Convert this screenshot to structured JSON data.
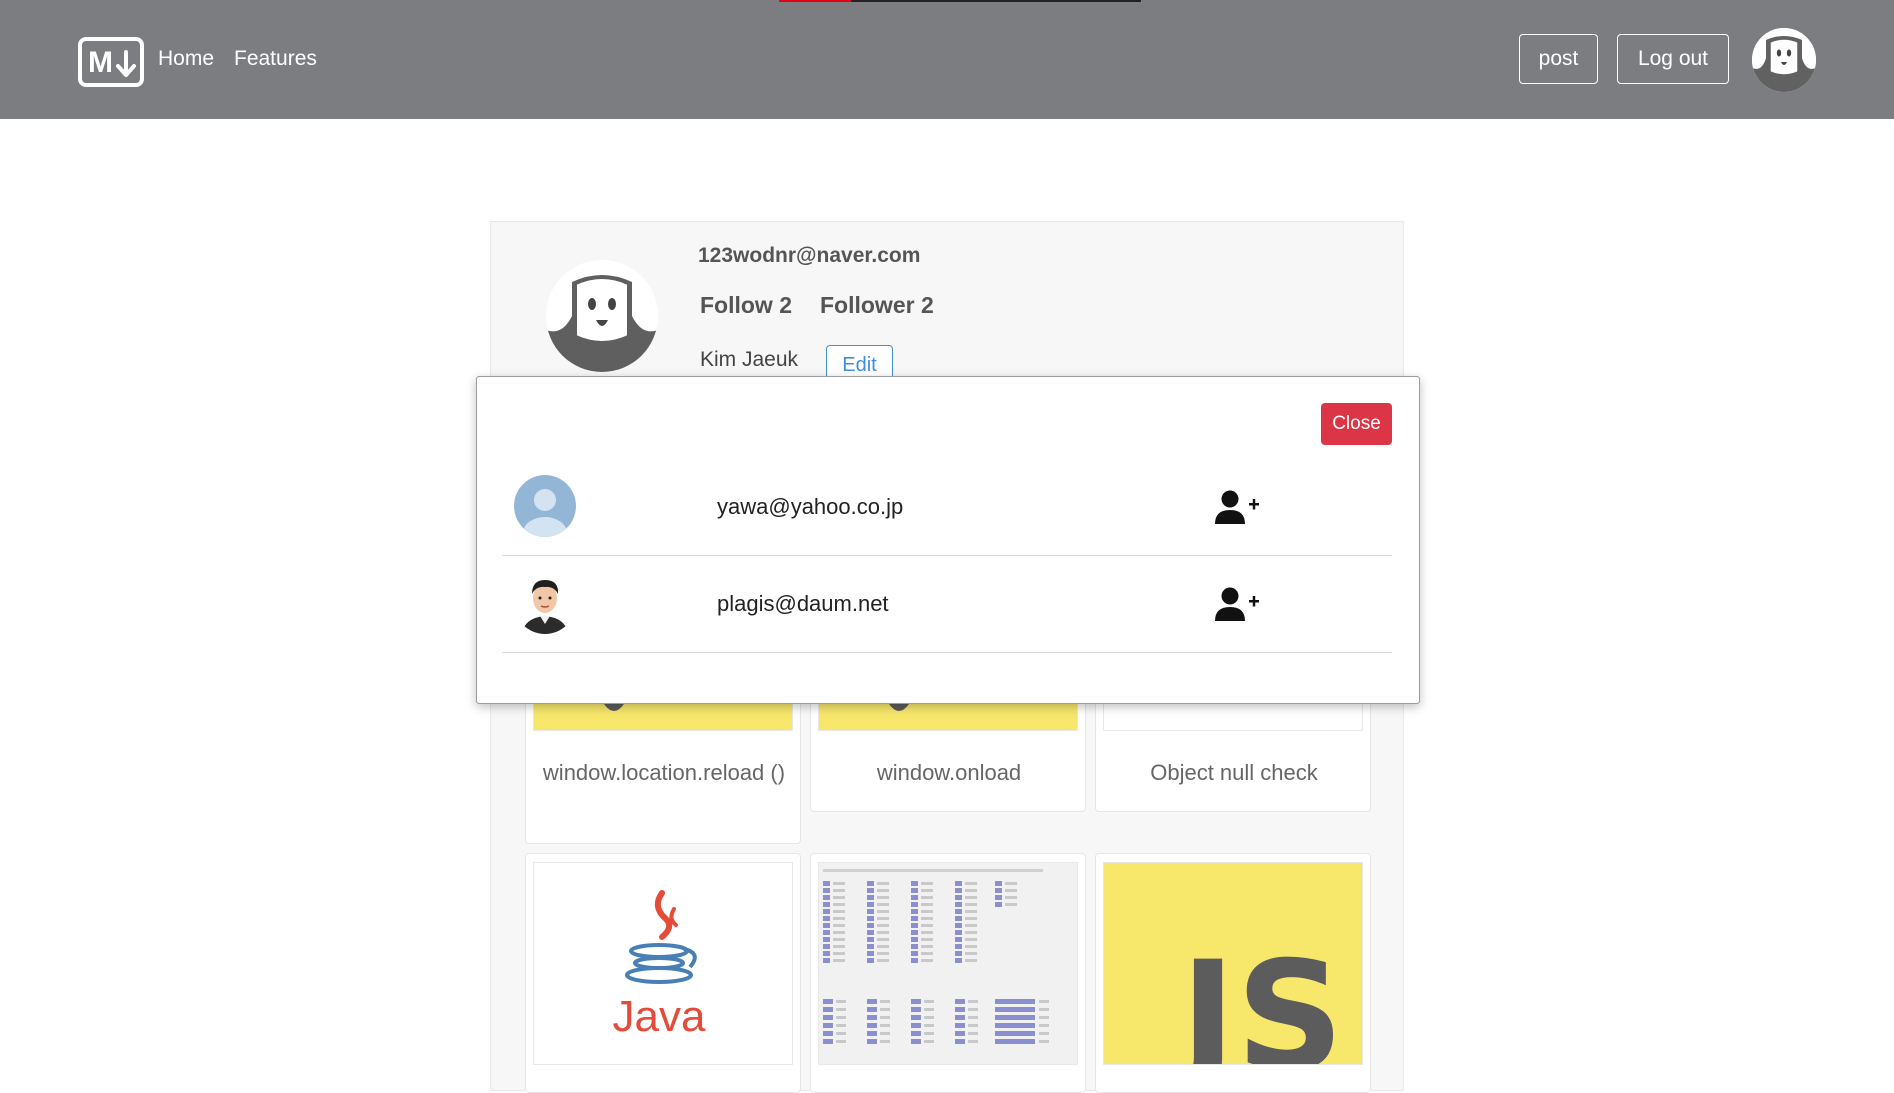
{
  "navbar": {
    "brand_logo_text": "M↓",
    "links": [
      "Home",
      "Features"
    ],
    "post_label": "post",
    "logout_label": "Log out",
    "background": "#7c7d80"
  },
  "profile": {
    "email": "123wodnr@naver.com",
    "follow_label": "Follow 2",
    "follower_label": "Follower 2",
    "name": "Kim Jaeuk",
    "edit_label": "Edit"
  },
  "posts": [
    {
      "title": "window.location.reload ()",
      "thumb": "js-logo"
    },
    {
      "title": "window.onload",
      "thumb": "js-logo"
    },
    {
      "title": "Object null check",
      "thumb": "blank"
    },
    {
      "title": "",
      "thumb": "java-logo",
      "thumb_text": "Java"
    },
    {
      "title": "",
      "thumb": "keycode-table"
    },
    {
      "title": "",
      "thumb": "js-logo",
      "thumb_text": "JS"
    }
  ],
  "modal": {
    "close_label": "Close",
    "users": [
      {
        "email": "yawa@yahoo.co.jp",
        "avatar": "default-avatar",
        "action": "add-user-icon"
      },
      {
        "email": "plagis@daum.net",
        "avatar": "cartoon-man-avatar",
        "action": "add-user-icon"
      }
    ]
  },
  "colors": {
    "accent_danger": "#dc3545",
    "accent_primary": "#3f8fd8",
    "js_yellow": "#f7e76b"
  }
}
